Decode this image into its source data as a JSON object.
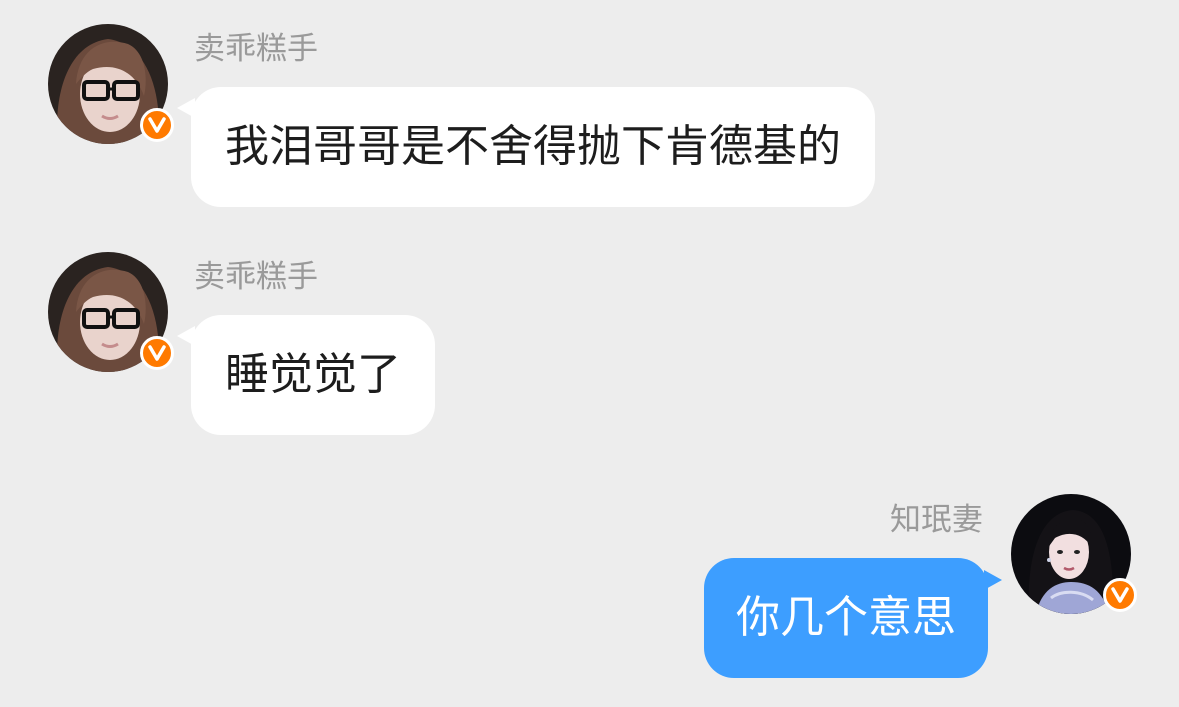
{
  "accent": "#3d9eff",
  "badge_color": "#ff7a00",
  "messages": [
    {
      "side": "in",
      "sender": "卖乖糕手",
      "avatar_icon": "user-avatar",
      "badge_icon": "verified-v-icon",
      "text": "我泪哥哥是不舍得抛下肯德基的"
    },
    {
      "side": "in",
      "sender": "卖乖糕手",
      "avatar_icon": "user-avatar",
      "badge_icon": "verified-v-icon",
      "text": "睡觉觉了"
    },
    {
      "side": "out",
      "sender": "知珉妻",
      "avatar_icon": "user-avatar",
      "badge_icon": "verified-v-icon",
      "text": "你几个意思"
    }
  ]
}
